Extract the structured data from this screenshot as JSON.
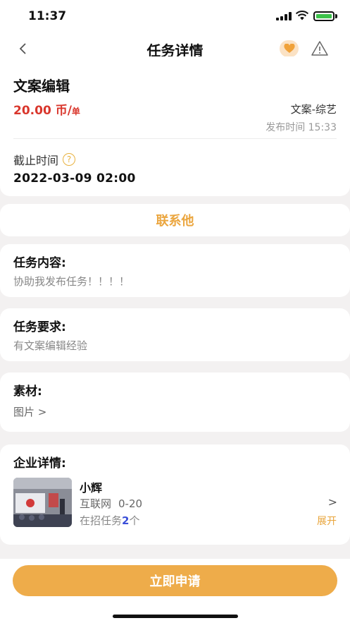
{
  "status_bar": {
    "time": "11:37"
  },
  "nav": {
    "title": "任务详情"
  },
  "task": {
    "title": "文案编辑",
    "price": "20.00 币/",
    "price_unit": "单",
    "category": "文案-综艺",
    "publish_time": "发布时间 15:33",
    "deadline_label": "截止时间",
    "deadline_help": "?",
    "deadline": "2022-03-09 02:00"
  },
  "contact": {
    "label": "联系他"
  },
  "content": {
    "title": "任务内容:",
    "body": "协助我发布任务！！！！"
  },
  "requirements": {
    "title": "任务要求:",
    "body": "有文案编辑经验"
  },
  "material": {
    "title": "素材:",
    "link": "图片 >"
  },
  "company": {
    "title": "企业详情:",
    "name": "小辉",
    "industry": "互联网",
    "size": "0-20",
    "jobs_prefix": "在招任务",
    "jobs_count": "2",
    "jobs_suffix": "个",
    "arrow": ">",
    "expand": "展开"
  },
  "footer": {
    "apply_label": "立即申请"
  },
  "icons": {
    "back": "chevron-left-icon",
    "favorite": "heart-icon",
    "report": "warning-icon",
    "help": "question-icon"
  },
  "colors": {
    "accent": "#eeac4a",
    "price": "#d9362c",
    "jobs_count": "#3a4ed8",
    "background": "#f3f1f1"
  }
}
